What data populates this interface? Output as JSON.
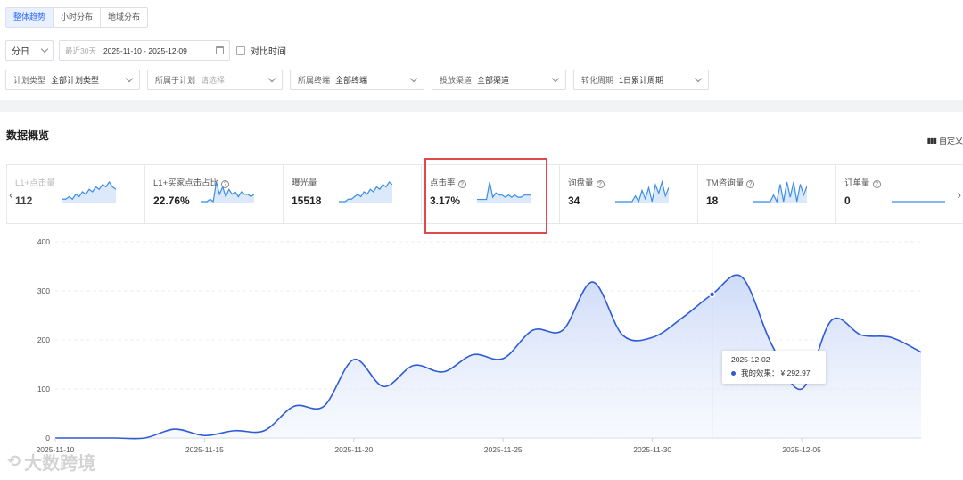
{
  "tabs": [
    "整体趋势",
    "小时分布",
    "地域分布"
  ],
  "date_row": {
    "granularity": "分日",
    "range_prefix": "最近30天",
    "range_value": "2025-11-10 - 2025-12-09",
    "compare_label": "对比时间"
  },
  "filters": [
    {
      "label": "计划类型",
      "value": "全部计划类型",
      "placeholder": false
    },
    {
      "label": "所属于计划",
      "value": "请选择",
      "placeholder": true
    },
    {
      "label": "所属终端",
      "value": "全部终端",
      "placeholder": false
    },
    {
      "label": "投放渠道",
      "value": "全部渠道",
      "placeholder": false
    },
    {
      "label": "转化周期",
      "value": "1日累计周期",
      "placeholder": false
    }
  ],
  "section_title": "数据概览",
  "customize_label": "自定义",
  "customize_icon": "columns-icon",
  "cards": [
    {
      "label": "L1+点击量",
      "value": "112",
      "help": false,
      "spark": [
        1,
        1,
        2,
        1,
        3,
        2,
        4,
        3,
        5,
        4,
        6,
        5,
        7,
        6,
        8,
        6,
        5
      ]
    },
    {
      "label": "L1+买家点击占比",
      "value": "22.76%",
      "help": true,
      "spark": [
        0,
        0,
        0,
        1,
        0,
        8,
        3,
        6,
        2,
        5,
        3,
        4,
        2,
        4,
        3,
        3,
        2,
        3
      ]
    },
    {
      "label": "曝光量",
      "value": "15518",
      "help": false,
      "spark": [
        0,
        0,
        0,
        1,
        1,
        2,
        3,
        2,
        4,
        3,
        5,
        4,
        6,
        5,
        7,
        6,
        8,
        7
      ]
    },
    {
      "label": "点击率",
      "value": "3.17%",
      "help": true,
      "spark": [
        1,
        1,
        1,
        1,
        9,
        2,
        4,
        3,
        3,
        2,
        3,
        2,
        3,
        2,
        2,
        3,
        3,
        3
      ]
    },
    {
      "label": "询盘量",
      "value": "34",
      "help": false,
      "spark": [
        0,
        0,
        0,
        0,
        0,
        0,
        2,
        0,
        4,
        1,
        5,
        0,
        6,
        3,
        7,
        2,
        5
      ]
    },
    {
      "label": "TM咨询量",
      "value": "18",
      "help": false,
      "spark": [
        0,
        0,
        0,
        0,
        0,
        0,
        3,
        0,
        8,
        0,
        9,
        2,
        9,
        0,
        8,
        3,
        7
      ]
    },
    {
      "label": "订单量",
      "value": "0",
      "help": true,
      "spark": [
        0,
        0,
        0,
        0,
        0,
        0,
        0,
        0,
        0,
        0
      ]
    }
  ],
  "nav": {
    "prev": "‹",
    "next": "›"
  },
  "tooltip": {
    "date": "2025-12-02",
    "series_label": "我的效果：",
    "value": "¥ 292.97"
  },
  "watermark": "大数跨境",
  "colors": {
    "accent": "#2f6bff",
    "line": "#2d5bd6",
    "highlight": "#e0494b"
  },
  "chart_data": {
    "type": "area",
    "x": [
      "2025-11-10",
      "2025-11-11",
      "2025-11-12",
      "2025-11-13",
      "2025-11-14",
      "2025-11-15",
      "2025-11-16",
      "2025-11-17",
      "2025-11-18",
      "2025-11-19",
      "2025-11-20",
      "2025-11-21",
      "2025-11-22",
      "2025-11-23",
      "2025-11-24",
      "2025-11-25",
      "2025-11-26",
      "2025-11-27",
      "2025-11-28",
      "2025-11-29",
      "2025-11-30",
      "2025-12-01",
      "2025-12-02",
      "2025-12-03",
      "2025-12-04",
      "2025-12-05",
      "2025-12-06",
      "2025-12-07",
      "2025-12-08",
      "2025-12-09"
    ],
    "x_ticks": [
      "2025-11-10",
      "2025-11-15",
      "2025-11-20",
      "2025-11-25",
      "2025-11-30",
      "2025-12-05"
    ],
    "series": [
      {
        "name": "我的效果",
        "values": [
          0,
          0,
          0,
          0,
          18,
          5,
          15,
          15,
          65,
          65,
          160,
          105,
          148,
          135,
          170,
          162,
          220,
          220,
          318,
          210,
          205,
          245,
          292.97,
          328,
          190,
          100,
          240,
          210,
          205,
          175
        ]
      }
    ],
    "ylim": [
      0,
      400
    ],
    "y_ticks": [
      0,
      100,
      200,
      300,
      400
    ],
    "highlight_x": "2025-12-02",
    "grid": true
  }
}
